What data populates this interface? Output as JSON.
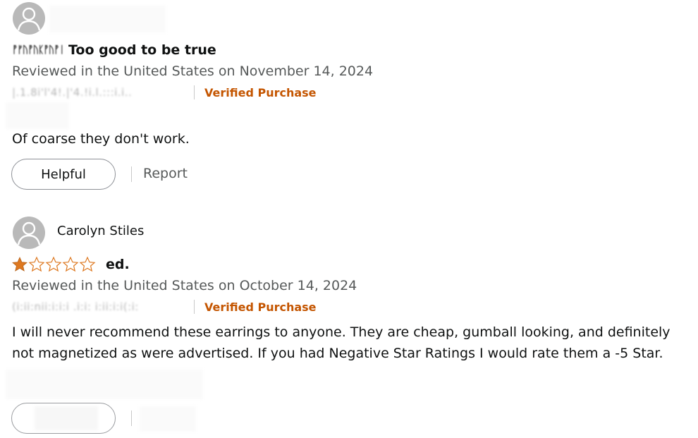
{
  "reviews": [
    {
      "reviewer_name": "",
      "title": "Too good to be true",
      "rating_out_of_5": null,
      "date_line": "Reviewed in the United States on November 14, 2024",
      "verified_label": "Verified Purchase",
      "body": "Of coarse they don't work.",
      "helpful_label": "Helpful",
      "report_label": "Report"
    },
    {
      "reviewer_name": "Carolyn Stiles",
      "title": "ed.",
      "rating_out_of_5": 1,
      "date_line": "Reviewed in the United States on October 14, 2024",
      "verified_label": "Verified Purchase",
      "body": "I will never recommend these earrings to anyone. They are cheap, gumball looking, and definitely not magnetized as were advertised. If you had Negative Star Ratings I would rate them a -5 Star.",
      "helpful_label": "",
      "report_label": ""
    }
  ],
  "colors": {
    "verified": "#c45500",
    "star_fill": "#de7921",
    "muted_text": "#565959",
    "avatar_bg": "#b9b9b9"
  },
  "icons": {
    "avatar": "default-user-avatar-icon",
    "star": "star-icon"
  }
}
